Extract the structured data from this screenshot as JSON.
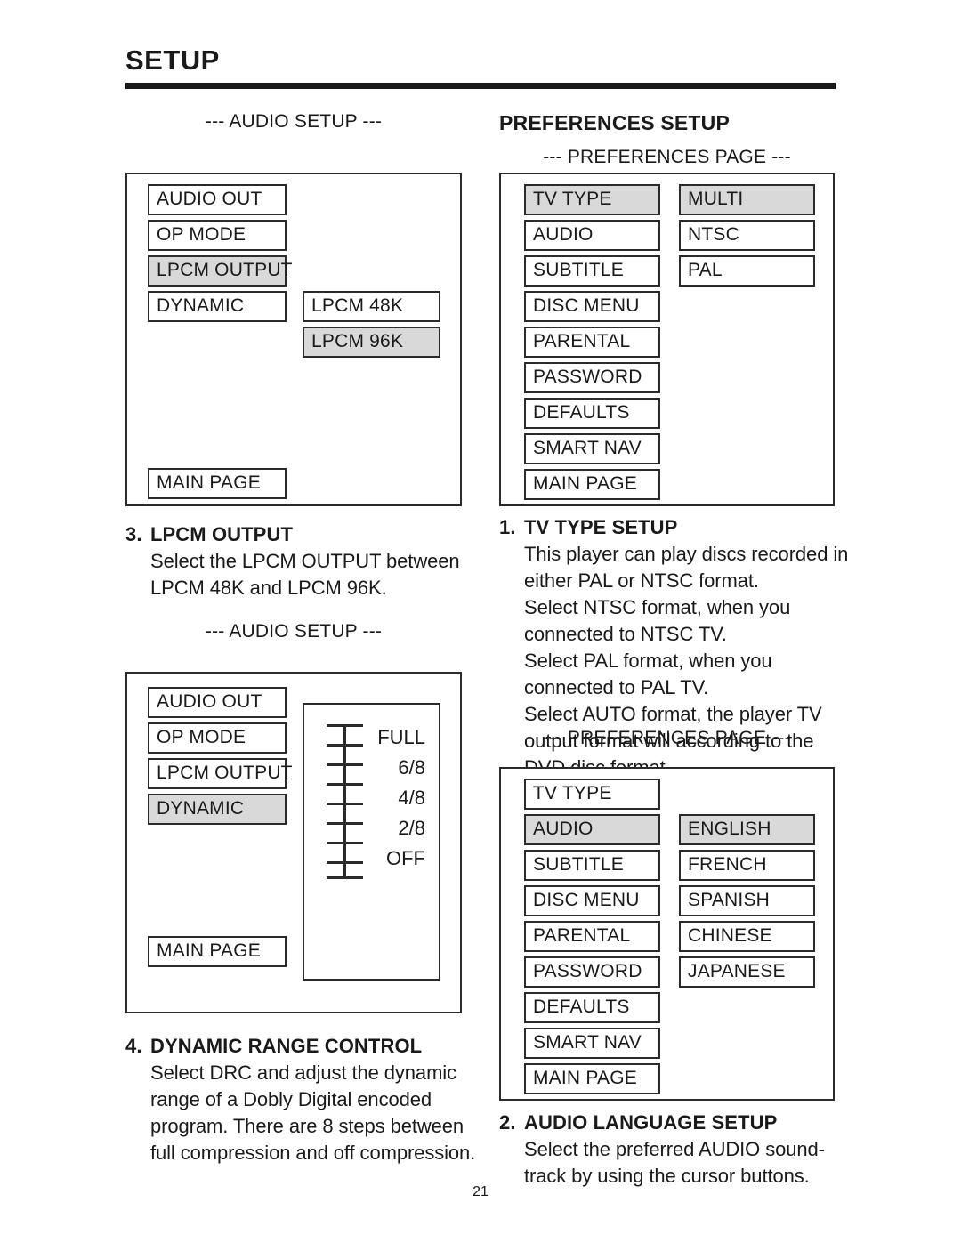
{
  "page": {
    "title": "SETUP",
    "number": "21"
  },
  "left_column": {
    "audio_setup_caption_1": "--- AUDIO SETUP ---",
    "lpcm_screen": {
      "menu_items": [
        {
          "label": "AUDIO OUT",
          "selected": false
        },
        {
          "label": "OP MODE",
          "selected": false
        },
        {
          "label": "LPCM OUTPUT",
          "selected": true
        },
        {
          "label": "DYNAMIC",
          "selected": false
        }
      ],
      "main_page_label": "MAIN PAGE",
      "options": [
        {
          "label": "LPCM 48K",
          "selected": false
        },
        {
          "label": "LPCM 96K",
          "selected": true
        }
      ]
    },
    "section_3": {
      "number": "3.",
      "heading": "LPCM OUTPUT",
      "lines": [
        "Select the LPCM OUTPUT between",
        "LPCM 48K and LPCM 96K."
      ]
    },
    "audio_setup_caption_2": "--- AUDIO SETUP ---",
    "drc_screen": {
      "menu_items": [
        {
          "label": "AUDIO OUT",
          "selected": false
        },
        {
          "label": "OP MODE",
          "selected": false
        },
        {
          "label": "LPCM OUTPUT",
          "selected": false
        },
        {
          "label": "DYNAMIC",
          "selected": true
        }
      ],
      "main_page_label": "MAIN PAGE",
      "slider": {
        "tick_count": 9,
        "labels": [
          "FULL",
          "6/8",
          "4/8",
          "2/8",
          "OFF"
        ]
      }
    },
    "section_4": {
      "number": "4.",
      "heading": "DYNAMIC RANGE CONTROL",
      "lines": [
        "Select DRC and adjust the dynamic",
        "range of a Dobly Digital encoded",
        "program.  There are 8 steps between",
        "full compression and off compression."
      ]
    }
  },
  "right_column": {
    "preferences_setup_title": "PREFERENCES SETUP",
    "preferences_caption_1": "--- PREFERENCES PAGE ---",
    "tvtype_screen": {
      "menu_items": [
        {
          "label": "TV TYPE",
          "selected": true
        },
        {
          "label": "AUDIO",
          "selected": false
        },
        {
          "label": "SUBTITLE",
          "selected": false
        },
        {
          "label": "DISC MENU",
          "selected": false
        },
        {
          "label": "PARENTAL",
          "selected": false
        },
        {
          "label": "PASSWORD",
          "selected": false
        },
        {
          "label": "DEFAULTS",
          "selected": false
        },
        {
          "label": "SMART NAV",
          "selected": false
        },
        {
          "label": "MAIN PAGE",
          "selected": false
        }
      ],
      "options": [
        {
          "label": "MULTI",
          "selected": true
        },
        {
          "label": "NTSC",
          "selected": false
        },
        {
          "label": "PAL",
          "selected": false
        }
      ]
    },
    "section_1": {
      "number": "1.",
      "heading": "TV TYPE SETUP",
      "lines": [
        "This player can play discs recorded in",
        "either PAL or NTSC format.",
        "Select NTSC format, when you",
        "connected to NTSC TV.",
        "Select PAL format, when you",
        "connected to PAL TV.",
        "Select AUTO format, the player TV",
        "output format will according to the",
        "DVD disc format."
      ]
    },
    "preferences_caption_2": "--- PREFERENCES PAGE ---",
    "audio_lang_screen": {
      "menu_items": [
        {
          "label": "TV TYPE",
          "selected": false
        },
        {
          "label": "AUDIO",
          "selected": true
        },
        {
          "label": "SUBTITLE",
          "selected": false
        },
        {
          "label": "DISC MENU",
          "selected": false
        },
        {
          "label": "PARENTAL",
          "selected": false
        },
        {
          "label": "PASSWORD",
          "selected": false
        },
        {
          "label": "DEFAULTS",
          "selected": false
        },
        {
          "label": "SMART NAV",
          "selected": false
        },
        {
          "label": "MAIN PAGE",
          "selected": false
        }
      ],
      "options": [
        {
          "label": "ENGLISH",
          "selected": true
        },
        {
          "label": "FRENCH",
          "selected": false
        },
        {
          "label": "SPANISH",
          "selected": false
        },
        {
          "label": "CHINESE",
          "selected": false
        },
        {
          "label": "JAPANESE",
          "selected": false
        }
      ]
    },
    "section_2": {
      "number": "2.",
      "heading": "AUDIO LANGUAGE SETUP",
      "lines": [
        "Select the preferred AUDIO sound-",
        "track by using the cursor buttons."
      ]
    }
  },
  "colors": {
    "ink": "#1a1a1a",
    "line": "#2b2b2b",
    "highlight": "#d9d9d9",
    "paper": "#ffffff"
  }
}
